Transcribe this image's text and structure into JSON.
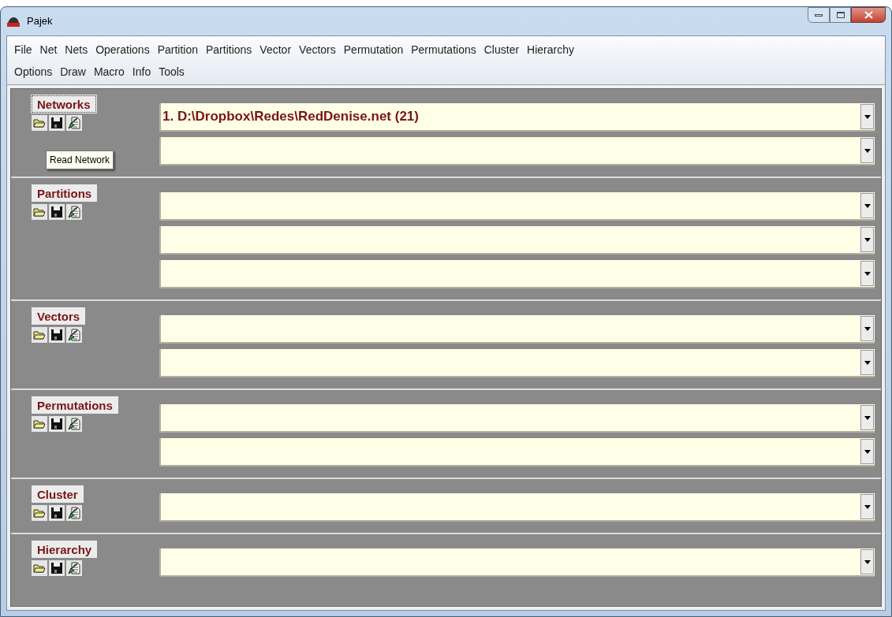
{
  "window": {
    "title": "Pajek"
  },
  "menu": [
    [
      "File",
      "Net",
      "Nets",
      "Operations",
      "Partition",
      "Partitions",
      "Vector",
      "Vectors",
      "Permutation",
      "Permutations",
      "Cluster",
      "Hierarchy"
    ],
    [
      "Options",
      "Draw",
      "Macro",
      "Info",
      "Tools"
    ]
  ],
  "sections": [
    {
      "label": "Networks",
      "focused": true,
      "tooltip": "Read Network",
      "combos": [
        {
          "kind": "combo",
          "value": "1. D:\\Dropbox\\Redes\\RedDenise.net (21)"
        },
        {
          "kind": "combo"
        }
      ]
    },
    {
      "label": "Partitions",
      "focused": false,
      "combos": [
        {
          "kind": "combo"
        },
        {
          "kind": "combo"
        },
        {
          "kind": "combo"
        }
      ]
    },
    {
      "label": "Vectors",
      "focused": false,
      "combos": [
        {
          "kind": "combo"
        },
        {
          "kind": "combo"
        }
      ]
    },
    {
      "label": "Permutations",
      "focused": false,
      "combos": [
        {
          "kind": "combo"
        },
        {
          "kind": "combo"
        }
      ]
    },
    {
      "label": "Cluster",
      "focused": false,
      "combos": [
        {
          "kind": "combo"
        }
      ]
    },
    {
      "label": "Hierarchy",
      "focused": false,
      "combos": [
        {
          "kind": "combo"
        }
      ]
    }
  ]
}
